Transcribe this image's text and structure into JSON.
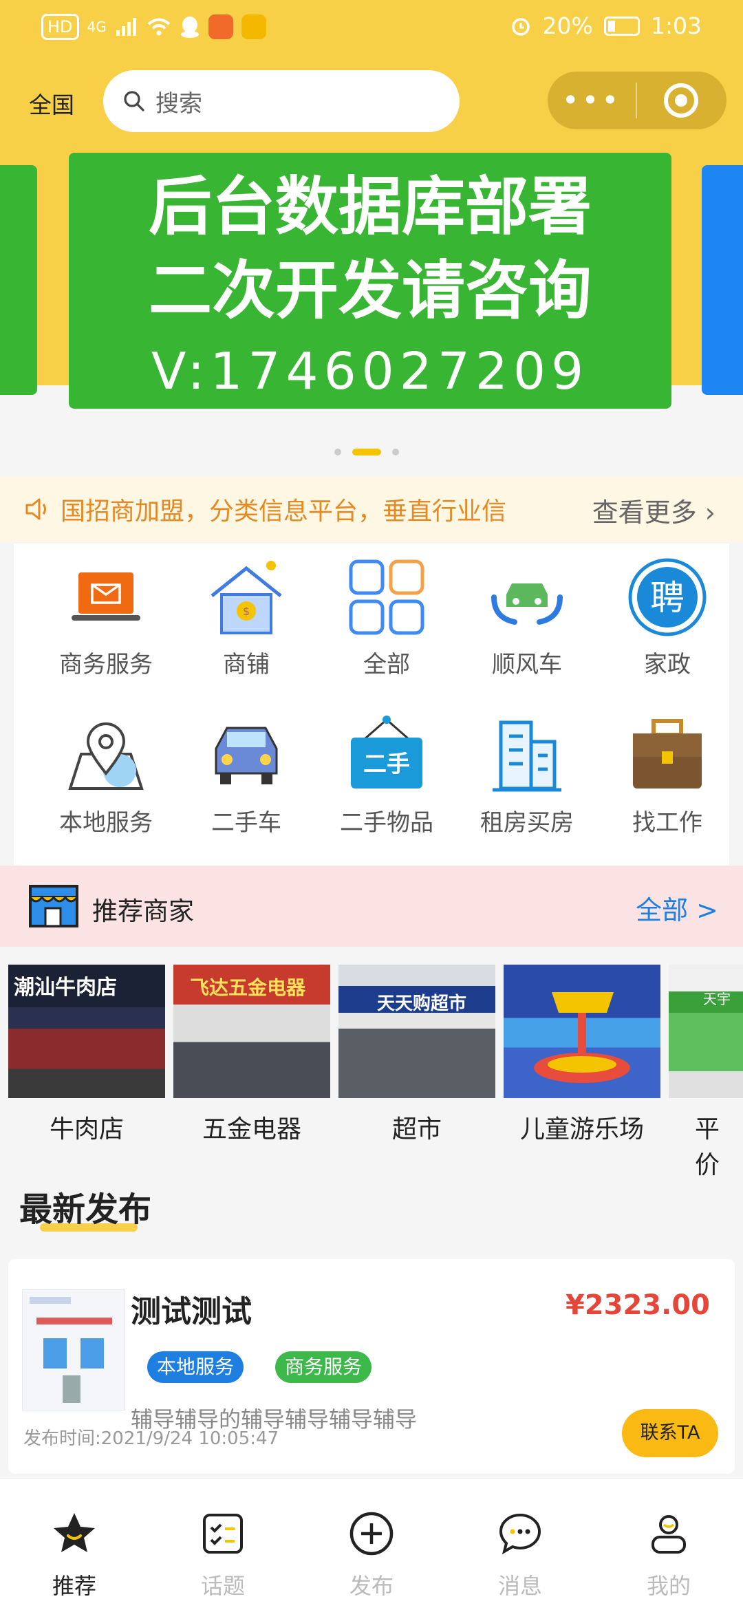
{
  "status_bar": {
    "left_text": "HD",
    "network": "4G",
    "battery": "20%",
    "time": "1:03"
  },
  "header": {
    "region": "全国",
    "search_placeholder": "搜索"
  },
  "banner": {
    "line1": "后台数据库部署",
    "line2": "二次开发请咨询",
    "line3": "V:1746027209"
  },
  "notice": {
    "text": "国招商加盟，分类信息平台，垂直行业信",
    "more": "查看更多"
  },
  "categories": [
    {
      "label": "商务服务",
      "icon": "laptop-mail-icon"
    },
    {
      "label": "商铺",
      "icon": "shop-house-icon"
    },
    {
      "label": "全部",
      "icon": "grid-icon"
    },
    {
      "label": "顺风车",
      "icon": "car-hands-icon"
    },
    {
      "label": "家政",
      "icon": "recruit-icon"
    },
    {
      "label": "本地服务",
      "icon": "location-map-icon"
    },
    {
      "label": "二手车",
      "icon": "car-icon"
    },
    {
      "label": "二手物品",
      "icon": "second-hand-sign-icon"
    },
    {
      "label": "租房买房",
      "icon": "building-icon"
    },
    {
      "label": "找工作",
      "icon": "briefcase-icon"
    }
  ],
  "recruit_char": "聘",
  "second_hand_text": "二手",
  "merchants": {
    "title": "推荐商家",
    "all": "全部 >",
    "items": [
      {
        "label": "牛肉店",
        "sign": "潮汕牛肉店"
      },
      {
        "label": "五金电器",
        "sign": "飞达五金电器"
      },
      {
        "label": "超市",
        "sign": "天天购超市"
      },
      {
        "label": "儿童游乐场",
        "sign": ""
      },
      {
        "label": "平价",
        "sign": "天宇"
      }
    ]
  },
  "latest": {
    "title": "最新发布",
    "post": {
      "title": "测试测试",
      "price": "¥2323.00",
      "tags": [
        "本地服务",
        "商务服务"
      ],
      "desc": "辅导辅导的辅导辅导辅导辅导",
      "time": "发布时间:2021/9/24 10:05:47",
      "contact": "联系TA"
    }
  },
  "tabbar": [
    {
      "label": "推荐",
      "icon": "star-face-icon",
      "active": true
    },
    {
      "label": "话题",
      "icon": "checklist-icon",
      "active": false
    },
    {
      "label": "发布",
      "icon": "plus-circle-icon",
      "active": false
    },
    {
      "label": "消息",
      "icon": "chat-bubble-icon",
      "active": false
    },
    {
      "label": "我的",
      "icon": "user-icon",
      "active": false
    }
  ],
  "colors": {
    "primary": "#f8d048",
    "banner": "#38b633",
    "accent_blue": "#1e7fe0",
    "price": "#e5463a",
    "notice": "#e58a23"
  }
}
